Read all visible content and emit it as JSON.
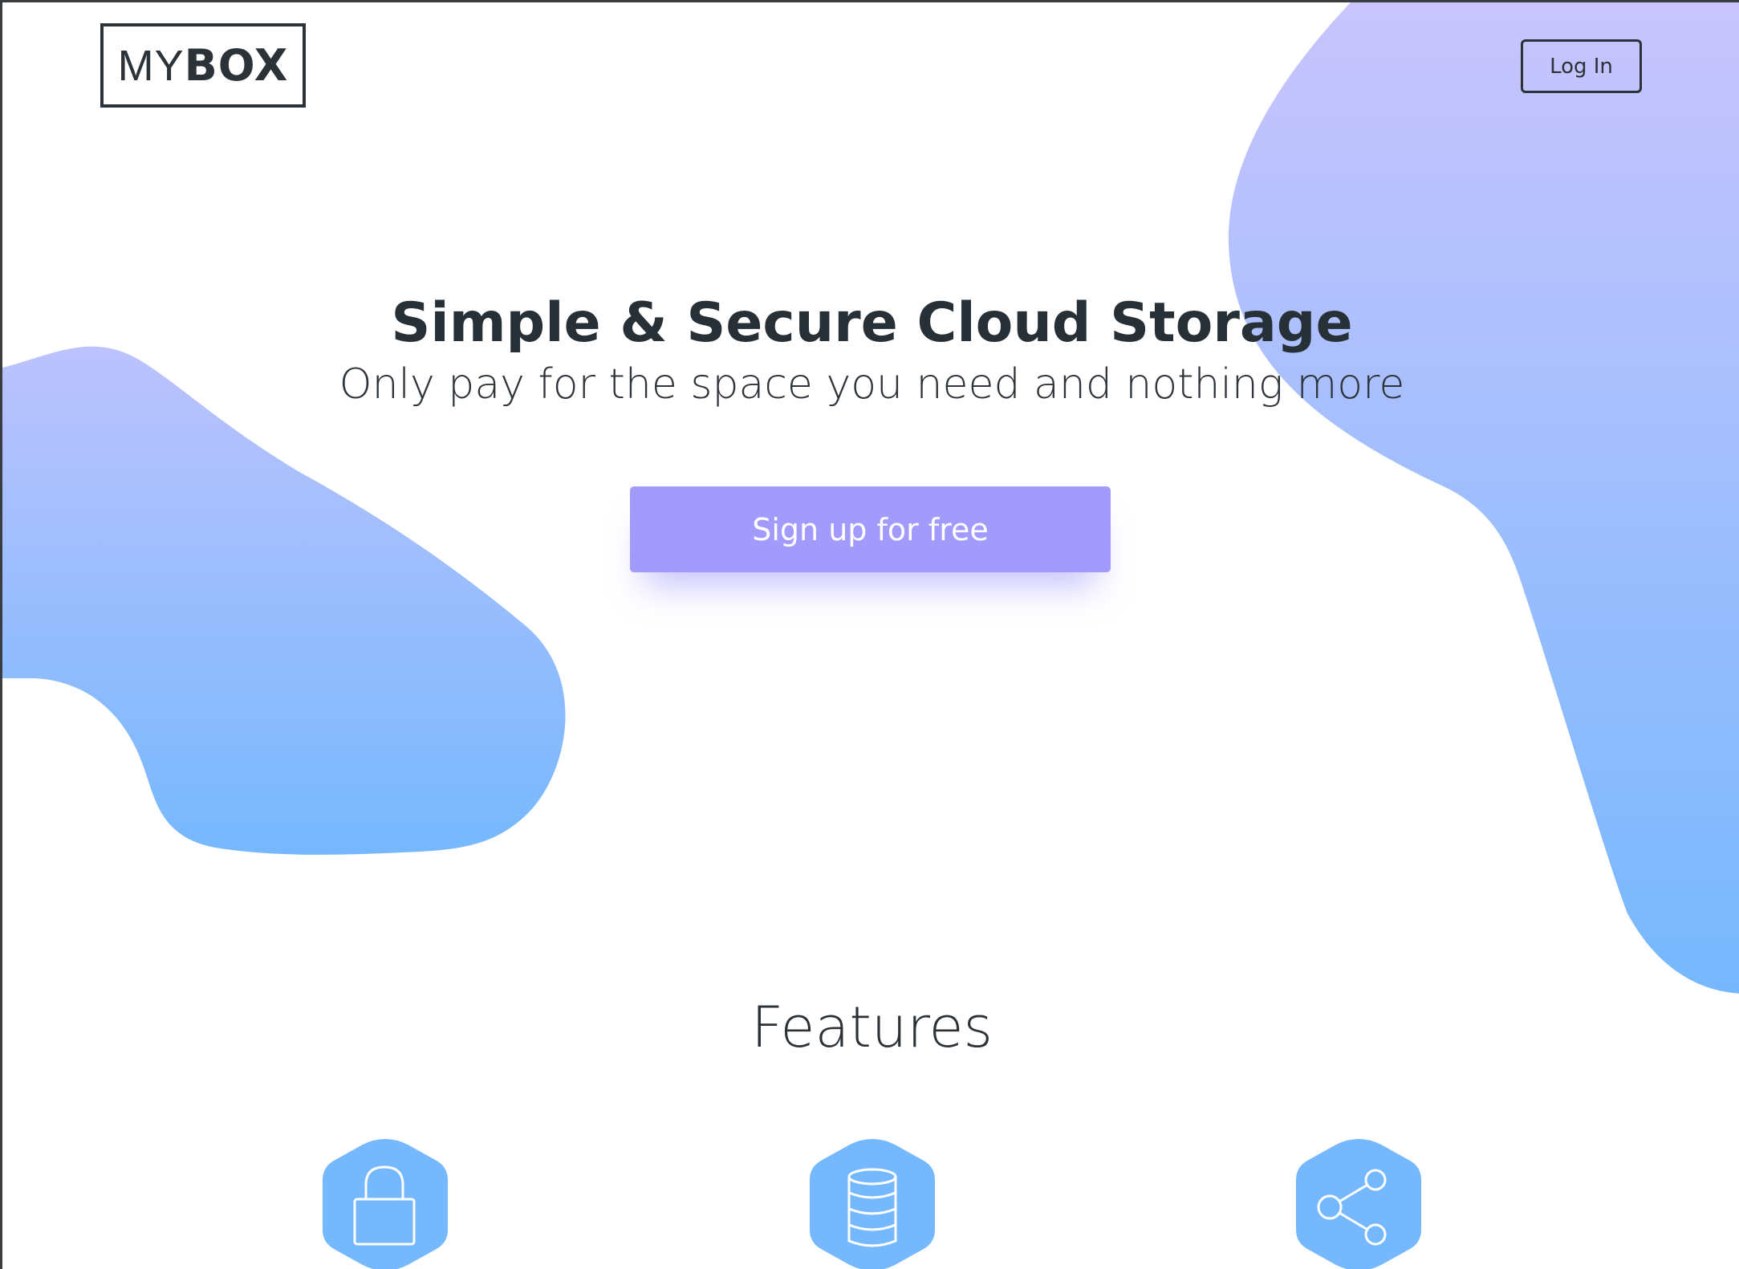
{
  "brand": {
    "logo_light": "MY",
    "logo_bold": "BOX"
  },
  "header": {
    "login_label": "Log In"
  },
  "hero": {
    "title": "Simple & Secure Cloud Storage",
    "subtitle": "Only pay for the space you need and nothing more",
    "cta_label": "Sign up for free"
  },
  "features": {
    "title": "Features",
    "items": [
      {
        "icon": "lock-icon"
      },
      {
        "icon": "database-icon"
      },
      {
        "icon": "share-icon"
      }
    ]
  },
  "colors": {
    "accent_purple": "#a29bfc",
    "blob_top": "#c9c4fd",
    "blob_bottom": "#76b8fd",
    "text_dark": "#2b3238"
  }
}
